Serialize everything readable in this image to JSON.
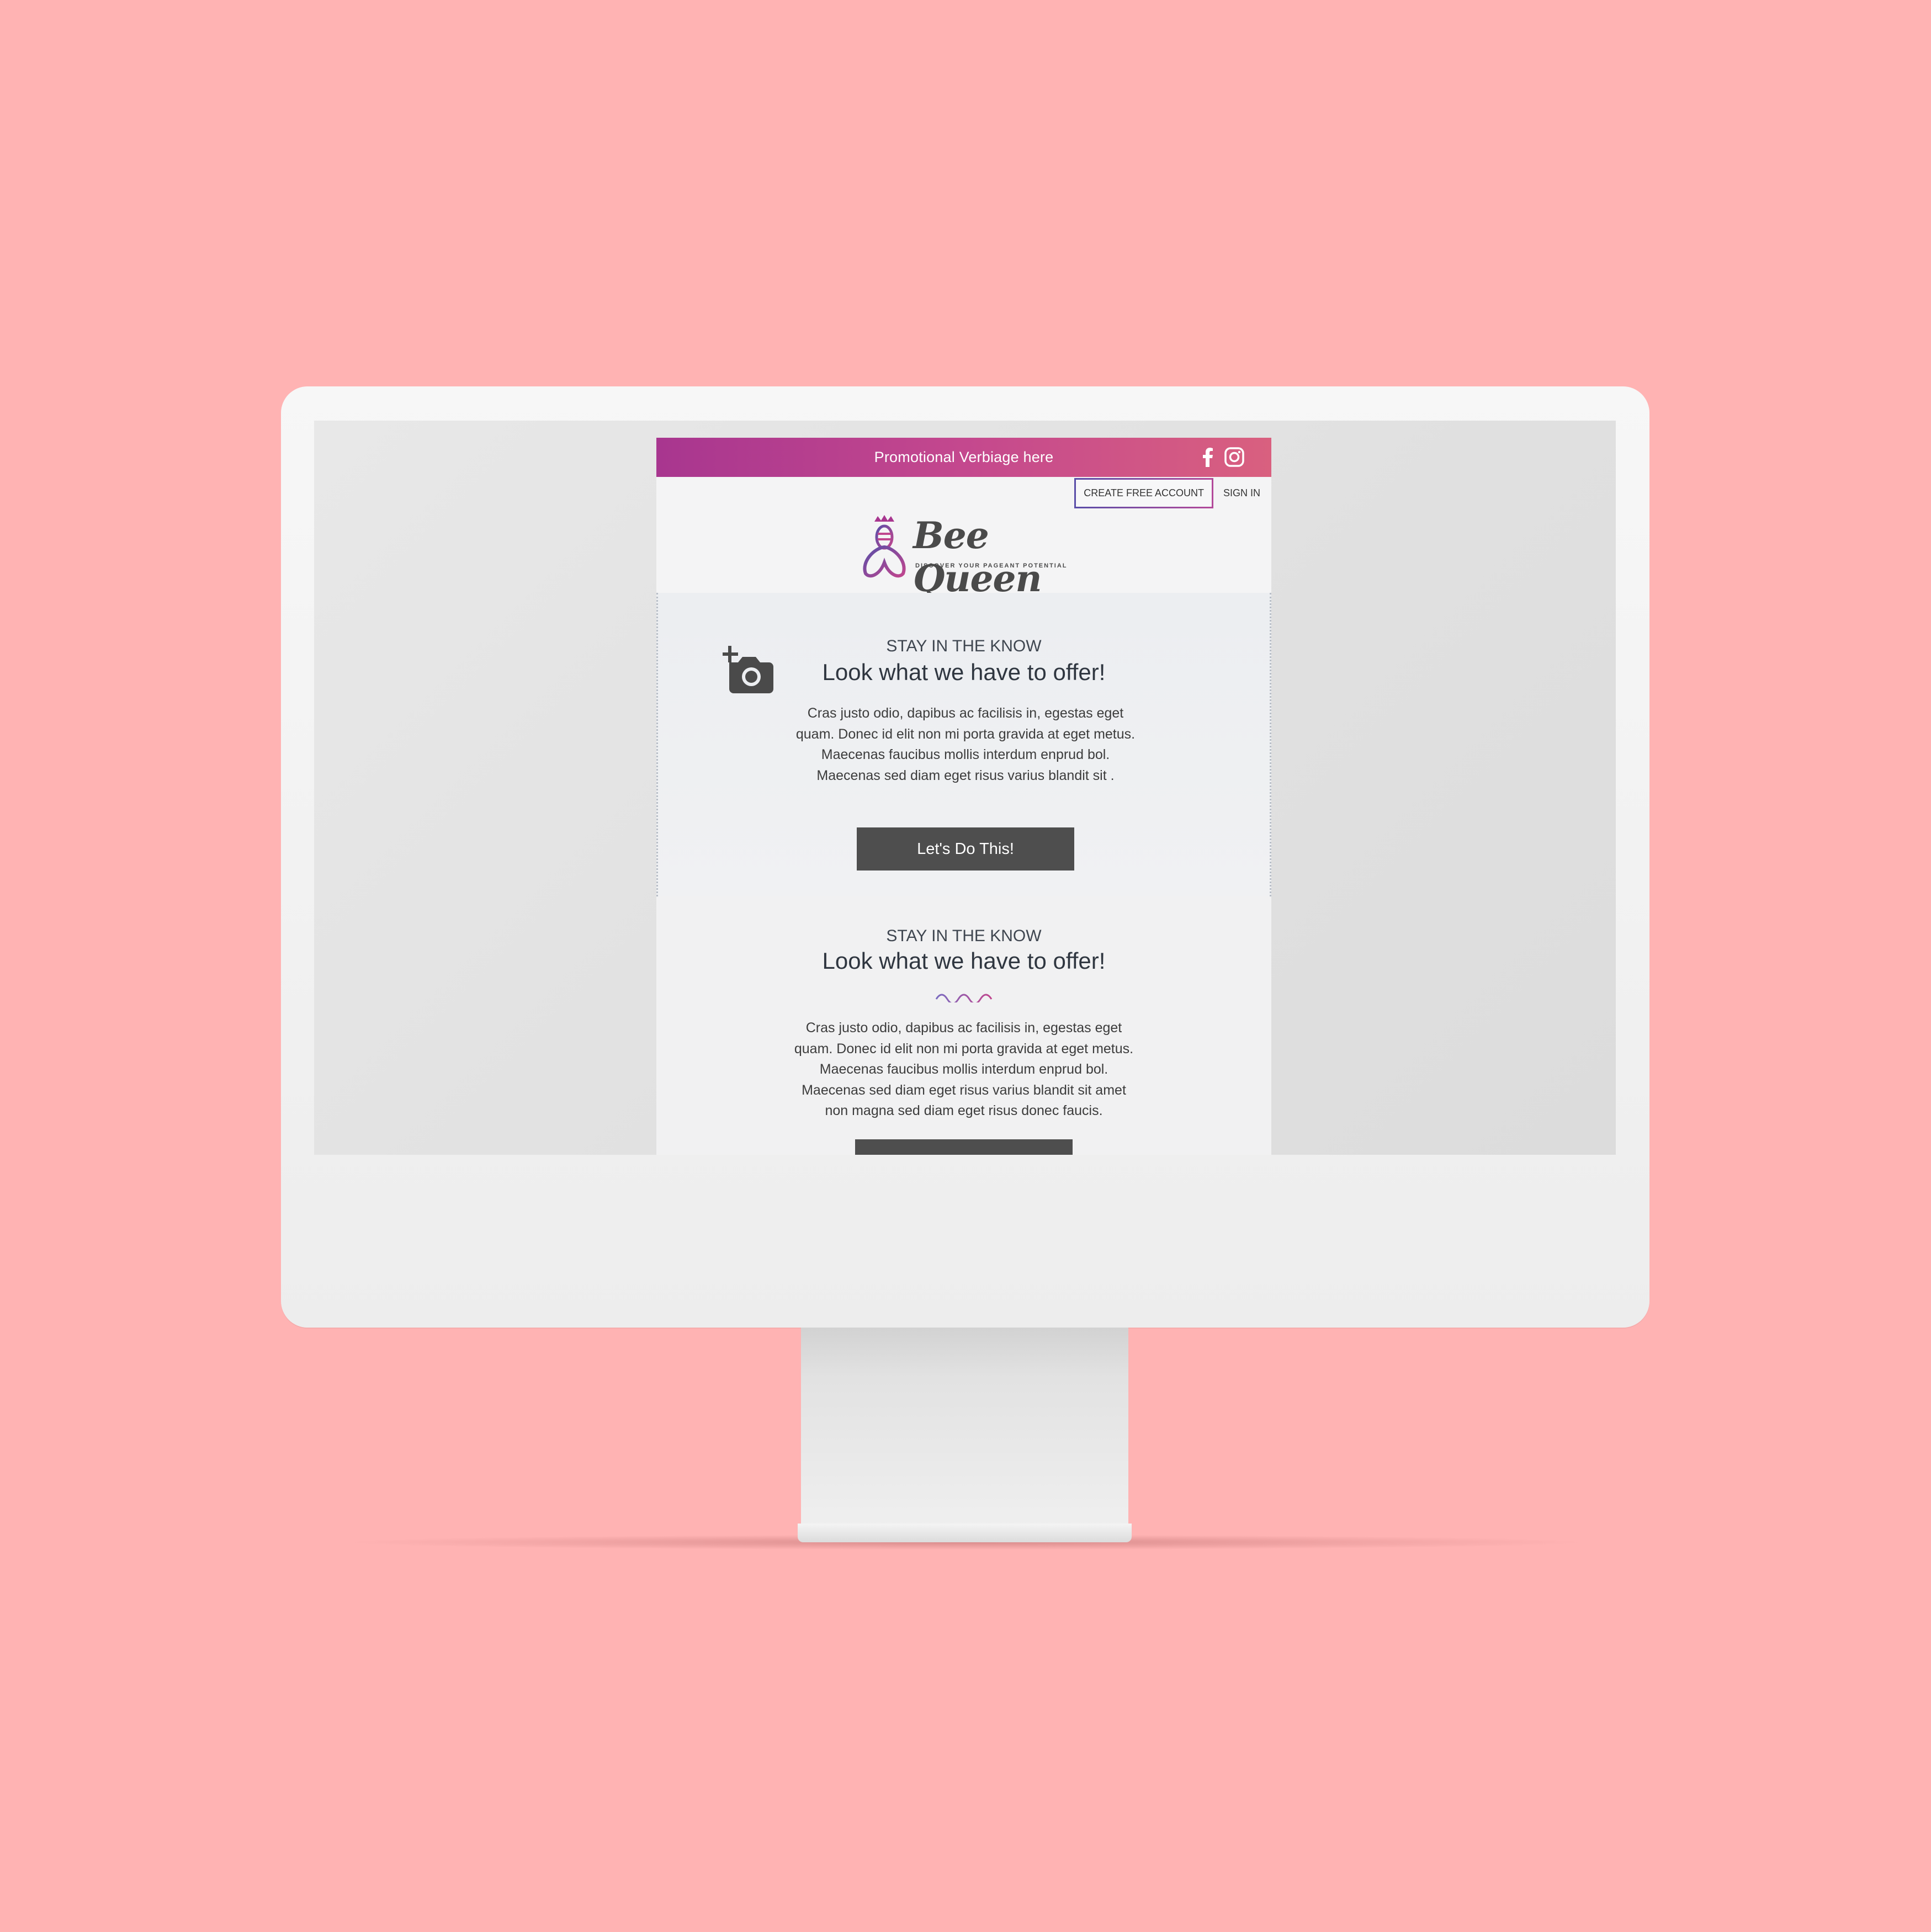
{
  "promo": {
    "text": "Promotional Verbiage here"
  },
  "social": {
    "facebook": "facebook-icon",
    "instagram": "instagram-icon"
  },
  "account": {
    "create_label": "CREATE FREE ACCOUNT",
    "signin_label": "SIGN IN"
  },
  "logo": {
    "title": "Bee Queen",
    "tagline": "DISCOVER YOUR PAGEANT POTENTIAL"
  },
  "section1": {
    "eyebrow": "STAY IN THE KNOW",
    "headline": "Look what we have to offer!",
    "body": "Cras justo odio, dapibus ac facilisis in, egestas eget quam. Donec id elit non mi porta gravida at eget metus. Maecenas faucibus mollis interdum enprud bol. Maecenas sed diam eget risus varius blandit sit .",
    "cta": "Let's Do This!",
    "icon": "add-photo-icon"
  },
  "section2": {
    "eyebrow": "STAY IN THE KNOW",
    "headline": "Look what we have to offer!",
    "body": "Cras justo odio, dapibus ac facilisis in, egestas eget quam. Donec id elit non mi porta gravida at eget metus. Maecenas faucibus mollis interdum enprud bol. Maecenas sed diam eget risus varius blandit sit amet non magna sed diam eget risus donec faucis.",
    "divider": "wave-divider"
  },
  "colors": {
    "background": "#ffb3b3",
    "promo_gradient_start": "#a8368f",
    "promo_gradient_end": "#d9607f",
    "button": "#4e4e4e",
    "text": "#2f3640"
  }
}
